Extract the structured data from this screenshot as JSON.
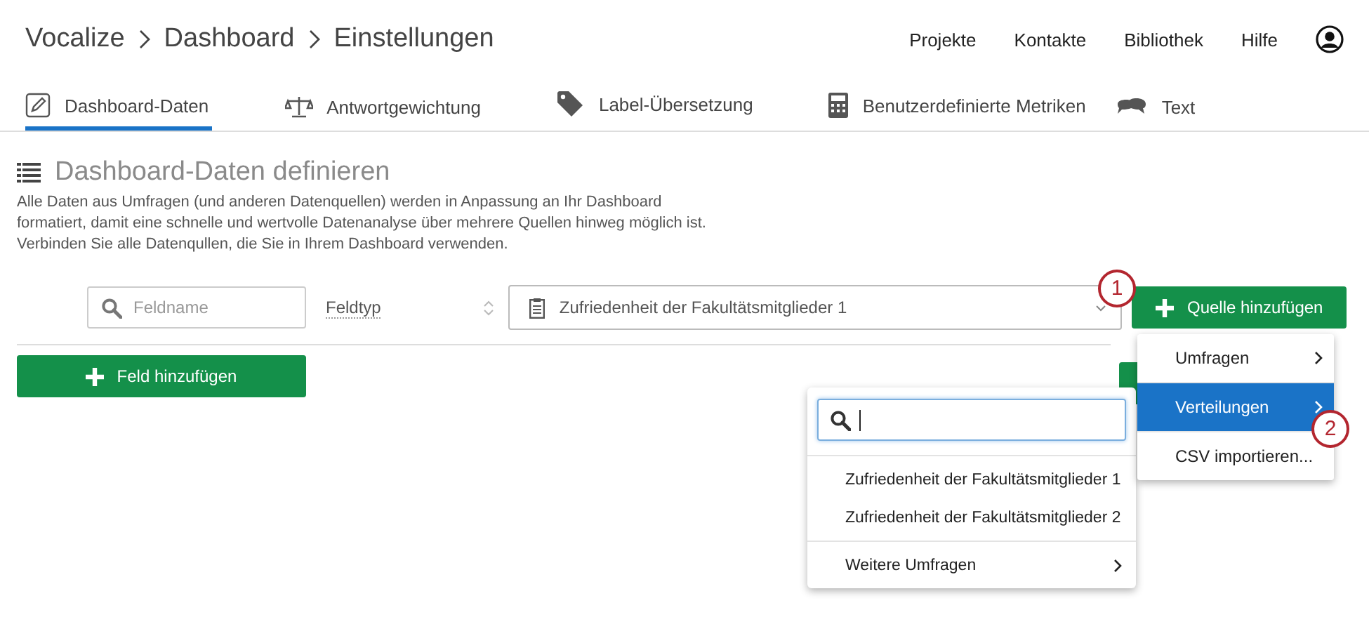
{
  "breadcrumb": [
    "Vocalize",
    "Dashboard",
    "Einstellungen"
  ],
  "nav_links": [
    "Projekte",
    "Kontakte",
    "Bibliothek",
    "Hilfe"
  ],
  "tabs": [
    {
      "label": "Dashboard-Daten",
      "selected": true
    },
    {
      "label": "Antwortgewichtung",
      "selected": false
    },
    {
      "label": "Label-Übersetzung",
      "selected": false
    },
    {
      "label": "Benutzerdefinierte Metriken",
      "selected": false
    },
    {
      "label": "Text",
      "selected": false
    }
  ],
  "section": {
    "title": "Dashboard-Daten definieren",
    "description": [
      "Alle Daten aus Umfragen (und anderen Datenquellen) werden in Anpassung an Ihr Dashboard",
      "formatiert, damit eine schnelle und wertvolle Datenanalyse über mehrere Quellen hinweg möglich ist.",
      "Verbinden Sie alle Datenqullen, die Sie in Ihrem Dashboard verwenden."
    ]
  },
  "toolbar": {
    "search": {
      "placeholder": "Feldname"
    },
    "field_type": "Feldtyp",
    "source_select": "Zufriedenheit der Fakultätsmitglieder 1",
    "add_source": "Quelle hinzufügen"
  },
  "add_field": "Feld hinzufügen",
  "source_menu": [
    {
      "label": "Umfragen",
      "selected": false
    },
    {
      "label": "Verteilungen",
      "selected": true
    },
    {
      "label": "CSV importieren...",
      "selected": false
    }
  ],
  "submenu": {
    "items": [
      {
        "kind": "item",
        "label": "Zufriedenheit der Fakultätsmitglieder 1"
      },
      {
        "kind": "item",
        "label": "Zufriedenheit der Fakultätsmitglieder 2"
      },
      {
        "kind": "submenu",
        "label": "Weitere Umfragen"
      }
    ]
  },
  "callouts": [
    "1",
    "2"
  ]
}
